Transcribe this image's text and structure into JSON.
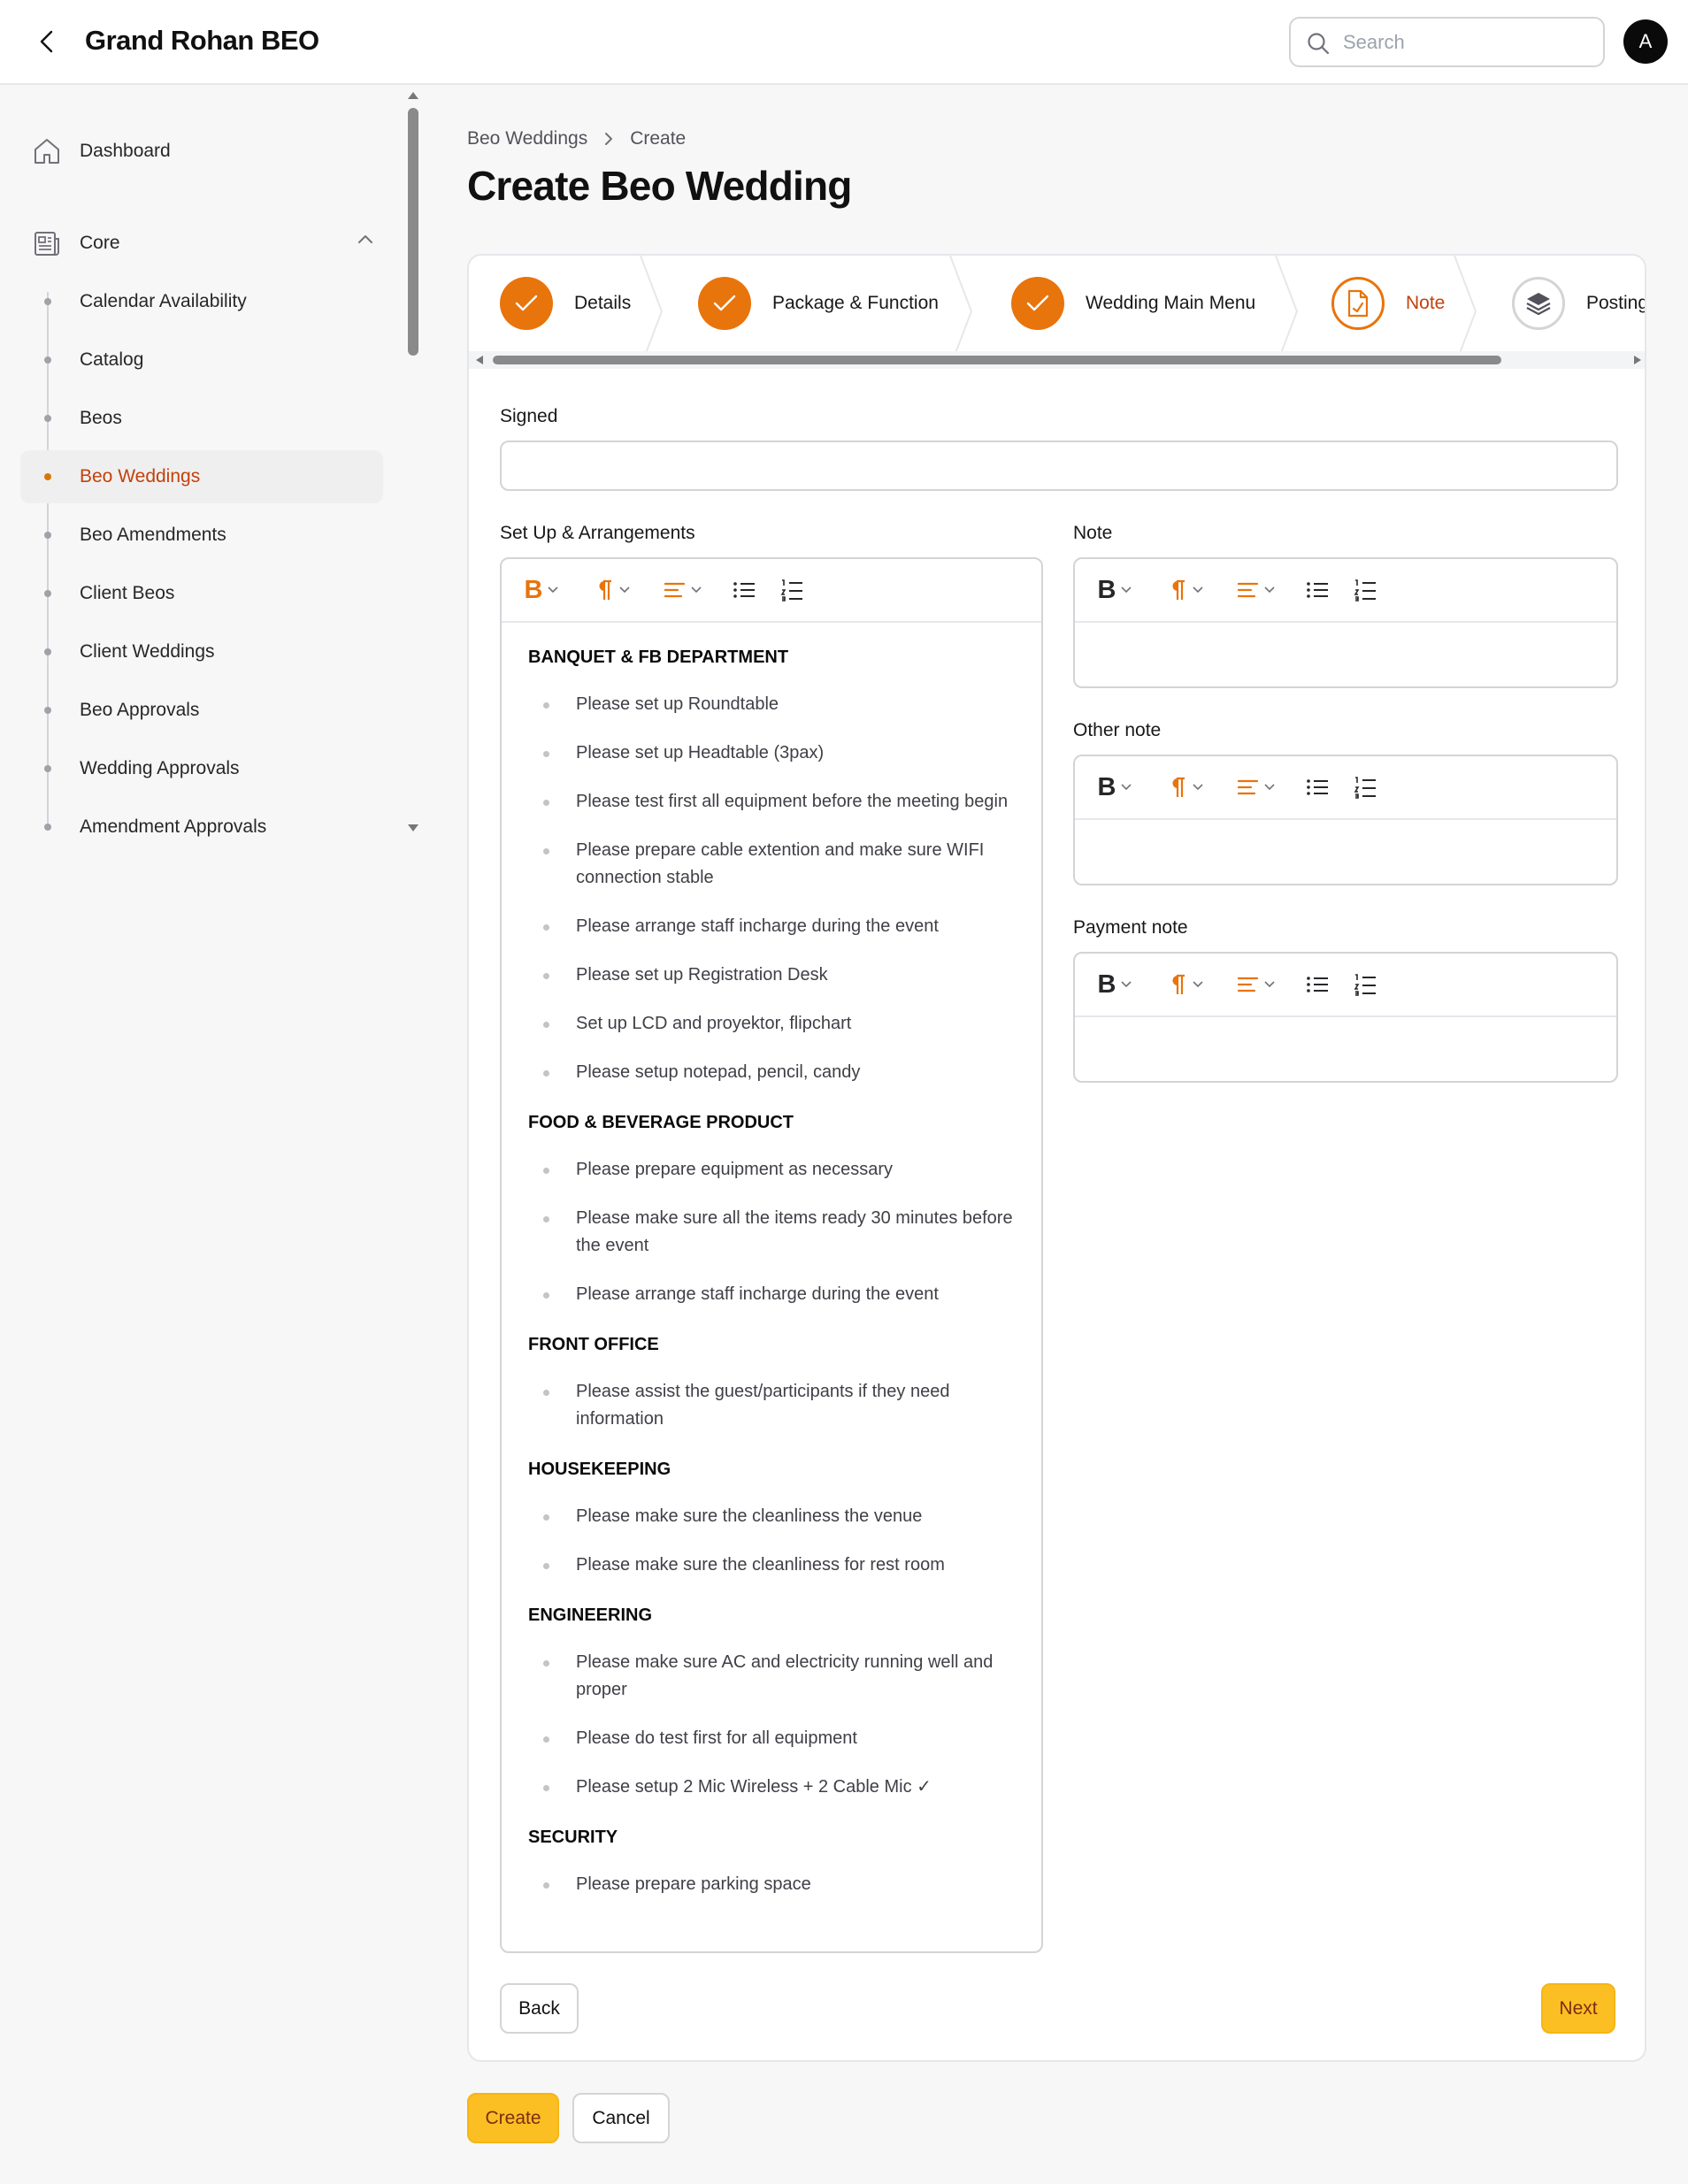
{
  "app": {
    "title": "Grand Rohan BEO",
    "avatar_initial": "A"
  },
  "search": {
    "placeholder": "Search"
  },
  "sidebar": {
    "dashboard": "Dashboard",
    "core": "Core",
    "items": [
      {
        "label": "Calendar Availability"
      },
      {
        "label": "Catalog"
      },
      {
        "label": "Beos"
      },
      {
        "label": "Beo Weddings"
      },
      {
        "label": "Beo Amendments"
      },
      {
        "label": "Client Beos"
      },
      {
        "label": "Client Weddings"
      },
      {
        "label": "Beo Approvals"
      },
      {
        "label": "Wedding Approvals"
      },
      {
        "label": "Amendment Approvals"
      }
    ],
    "active": "Beo Weddings"
  },
  "breadcrumb": {
    "parent": "Beo Weddings",
    "current": "Create"
  },
  "page": {
    "title": "Create Beo Wedding"
  },
  "steps": [
    {
      "label": "Details",
      "status": "done"
    },
    {
      "label": "Package & Function",
      "status": "done"
    },
    {
      "label": "Wedding Main Menu",
      "status": "done"
    },
    {
      "label": "Note",
      "status": "current"
    },
    {
      "label": "Posting",
      "status": "pending"
    }
  ],
  "form": {
    "signed_label": "Signed",
    "signed_value": "",
    "setup_label": "Set Up & Arrangements",
    "note_label": "Note",
    "other_note_label": "Other note",
    "payment_note_label": "Payment note"
  },
  "setup_content": [
    {
      "heading": "BANQUET & FB DEPARTMENT",
      "items": [
        "Please set up Roundtable",
        "Please set up Headtable (3pax)",
        "Please test first all equipment before the meeting begin",
        "Please prepare cable extention and make sure WIFI connection stable",
        "Please arrange staff incharge during the event",
        "Please set up Registration Desk",
        "Set up LCD and proyektor, flipchart",
        "Please setup notepad, pencil, candy"
      ]
    },
    {
      "heading": "FOOD & BEVERAGE PRODUCT",
      "items": [
        "Please prepare equipment as necessary",
        "Please make sure all the items ready 30 minutes before the event",
        "Please arrange staff incharge during the event"
      ]
    },
    {
      "heading": "FRONT OFFICE",
      "items": [
        "Please assist the guest/participants if they need information"
      ]
    },
    {
      "heading": "HOUSEKEEPING",
      "items": [
        "Please make sure the cleanliness the venue",
        "Please make sure the cleanliness for rest room"
      ]
    },
    {
      "heading": "ENGINEERING",
      "items": [
        "Please make sure AC and electricity running well and proper",
        "Please do test first for all equipment",
        "Please setup 2 Mic Wireless + 2 Cable Mic ✓"
      ]
    },
    {
      "heading": "SECURITY",
      "items": [
        "Please prepare parking space"
      ]
    }
  ],
  "buttons": {
    "back": "Back",
    "next": "Next",
    "create": "Create",
    "cancel": "Cancel"
  },
  "colors": {
    "accent": "#e8740c",
    "accent_text": "#c2410c",
    "primary_button": "#fbbf24"
  },
  "icons": {
    "back": "chevron-left-icon",
    "search": "search-icon",
    "dashboard": "home-icon",
    "core": "newspaper-icon",
    "step_done": "check-icon",
    "step_current": "document-icon",
    "step_pending": "layers-icon"
  }
}
